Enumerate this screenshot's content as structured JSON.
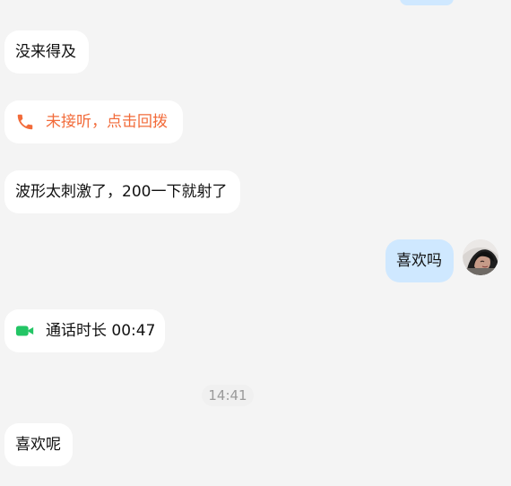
{
  "messages": [
    {
      "text": "没来得及"
    },
    {
      "text": "未接听，点击回拨"
    },
    {
      "text": "波形太刺激了，200一下就射了"
    },
    {
      "text": "喜欢吗"
    },
    {
      "text": "通话时长 00:47"
    },
    {
      "text": "喜欢呢"
    }
  ],
  "time_divider": "14:41",
  "colors": {
    "background": "#f4f4f4",
    "incoming_bubble": "#ffffff",
    "outgoing_bubble": "#cfe8ff",
    "missed_call": "#f26b3a",
    "video_call": "#23c565",
    "time_text": "#9a9a9a"
  },
  "icons": {
    "missed_call_icon": "phone-icon",
    "video_call_icon": "video-call-icon",
    "avatar": "user-avatar"
  }
}
